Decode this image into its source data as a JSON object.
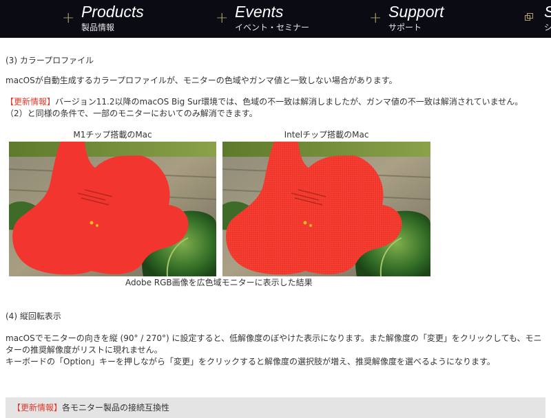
{
  "nav": {
    "items": [
      {
        "en": "Products",
        "jp": "製品情報"
      },
      {
        "en": "Events",
        "jp": "イベント・セミナー"
      },
      {
        "en": "Support",
        "jp": "サポート"
      },
      {
        "en": "S",
        "jp": "シ"
      }
    ],
    "plus_symbol": "+",
    "colors": {
      "background": "#0b0b14",
      "plus": "#b9a46a"
    }
  },
  "section3": {
    "heading": "(3) カラープロファイル",
    "body": "macOSが自動生成するカラープロファイルが、モニターの色域やガンマ値と一致しない場合があります。",
    "update_tag": "【更新情報】",
    "update_text": "バージョン11.2以降のmacOS Big Sur環境では、色域の不一致は解消しましたが、ガンマ値の不一致は解消されていません。",
    "update_text2": "（2）と同様の条件で、一部のモニターにおいてのみ解消できます。"
  },
  "figure": {
    "left_title": "M1チップ搭載のMac",
    "right_title": "Intelチップ搭載のMac",
    "caption": "Adobe RGB画像を広色域モニターに表示した結果",
    "colors": {
      "flower": "#f2362f",
      "leaf": "#3a7a2e",
      "wood": "#9a8a6e"
    }
  },
  "section4": {
    "heading": "(4) 縦回転表示",
    "body1": "macOSでモニターの向きを縦 (90° / 270°) に設定すると、低解像度のぼやけた表示になります。また解像度の「変更」をクリックしても、モニ",
    "body2": "ターの推奨解像度がリストに現れません。",
    "body3": "キーボードの「Option」キーを押しながら「変更」をクリックすると解像度の選択肢が増え、推奨解像度を選べるようになります。"
  },
  "bottom": {
    "update_tag": "【更新情報】",
    "text": "各モニター製品の接続互換性"
  },
  "accent": {
    "red": "#e03b2b"
  }
}
